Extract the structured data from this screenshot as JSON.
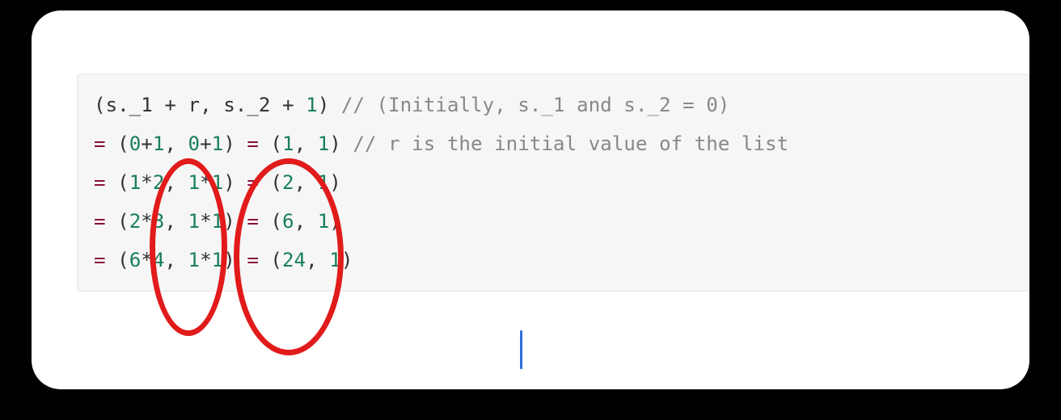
{
  "code": {
    "lines": [
      {
        "tokens": [
          {
            "t": "(",
            "c": "pn"
          },
          {
            "t": "s._1 ",
            "c": "pn"
          },
          {
            "t": "+",
            "c": "op"
          },
          {
            "t": " r",
            "c": "pn"
          },
          {
            "t": ", ",
            "c": "pn"
          },
          {
            "t": "s._2 ",
            "c": "pn"
          },
          {
            "t": "+",
            "c": "op"
          },
          {
            "t": " ",
            "c": "pn"
          },
          {
            "t": "1",
            "c": "num"
          },
          {
            "t": ") ",
            "c": "pn"
          },
          {
            "t": "// (Initially, s._1 and s._2 = 0)",
            "c": "cmt"
          }
        ]
      },
      {
        "tokens": [
          {
            "t": "=",
            "c": "key"
          },
          {
            "t": " (",
            "c": "pn"
          },
          {
            "t": "0",
            "c": "num"
          },
          {
            "t": "+",
            "c": "op"
          },
          {
            "t": "1",
            "c": "num"
          },
          {
            "t": ", ",
            "c": "pn"
          },
          {
            "t": "0",
            "c": "num"
          },
          {
            "t": "+",
            "c": "op"
          },
          {
            "t": "1",
            "c": "num"
          },
          {
            "t": ") ",
            "c": "pn"
          },
          {
            "t": "=",
            "c": "key"
          },
          {
            "t": " (",
            "c": "pn"
          },
          {
            "t": "1",
            "c": "num"
          },
          {
            "t": ", ",
            "c": "pn"
          },
          {
            "t": "1",
            "c": "num"
          },
          {
            "t": ") ",
            "c": "pn"
          },
          {
            "t": "// r is the initial value of the list",
            "c": "cmt"
          }
        ]
      },
      {
        "tokens": [
          {
            "t": "=",
            "c": "key"
          },
          {
            "t": " (",
            "c": "pn"
          },
          {
            "t": "1",
            "c": "num"
          },
          {
            "t": "*",
            "c": "op"
          },
          {
            "t": "2",
            "c": "num"
          },
          {
            "t": ", ",
            "c": "pn"
          },
          {
            "t": "1",
            "c": "num"
          },
          {
            "t": "*",
            "c": "op"
          },
          {
            "t": "1",
            "c": "num"
          },
          {
            "t": ") ",
            "c": "pn"
          },
          {
            "t": "=",
            "c": "key"
          },
          {
            "t": " (",
            "c": "pn"
          },
          {
            "t": "2",
            "c": "num"
          },
          {
            "t": ", ",
            "c": "pn"
          },
          {
            "t": "1",
            "c": "num"
          },
          {
            "t": ")",
            "c": "pn"
          }
        ]
      },
      {
        "tokens": [
          {
            "t": "=",
            "c": "key"
          },
          {
            "t": " (",
            "c": "pn"
          },
          {
            "t": "2",
            "c": "num"
          },
          {
            "t": "*",
            "c": "op"
          },
          {
            "t": "3",
            "c": "num"
          },
          {
            "t": ", ",
            "c": "pn"
          },
          {
            "t": "1",
            "c": "num"
          },
          {
            "t": "*",
            "c": "op"
          },
          {
            "t": "1",
            "c": "num"
          },
          {
            "t": ") ",
            "c": "pn"
          },
          {
            "t": "=",
            "c": "key"
          },
          {
            "t": " (",
            "c": "pn"
          },
          {
            "t": "6",
            "c": "num"
          },
          {
            "t": ", ",
            "c": "pn"
          },
          {
            "t": "1",
            "c": "num"
          },
          {
            "t": ")",
            "c": "pn"
          }
        ]
      },
      {
        "tokens": [
          {
            "t": "=",
            "c": "key"
          },
          {
            "t": " (",
            "c": "pn"
          },
          {
            "t": "6",
            "c": "num"
          },
          {
            "t": "*",
            "c": "op"
          },
          {
            "t": "4",
            "c": "num"
          },
          {
            "t": ", ",
            "c": "pn"
          },
          {
            "t": "1",
            "c": "num"
          },
          {
            "t": "*",
            "c": "op"
          },
          {
            "t": "1",
            "c": "num"
          },
          {
            "t": ") ",
            "c": "pn"
          },
          {
            "t": "=",
            "c": "key"
          },
          {
            "t": " (",
            "c": "pn"
          },
          {
            "t": "24",
            "c": "num"
          },
          {
            "t": ", ",
            "c": "pn"
          },
          {
            "t": "1",
            "c": "num"
          },
          {
            "t": ")",
            "c": "pn"
          }
        ]
      }
    ]
  },
  "annotations": {
    "ellipses": [
      {
        "id": "ell1",
        "purpose": "circle-column-first-element"
      },
      {
        "id": "ell2",
        "purpose": "circle-column-second-element"
      }
    ],
    "caret": {
      "visible": true
    }
  },
  "colors": {
    "ellipse_stroke": "#e11b1b",
    "caret": "#2f6fe0",
    "code_bg": "#f6f6f6",
    "number": "#1a7f5a",
    "keyword": "#8a0f3c",
    "comment": "#888888"
  }
}
